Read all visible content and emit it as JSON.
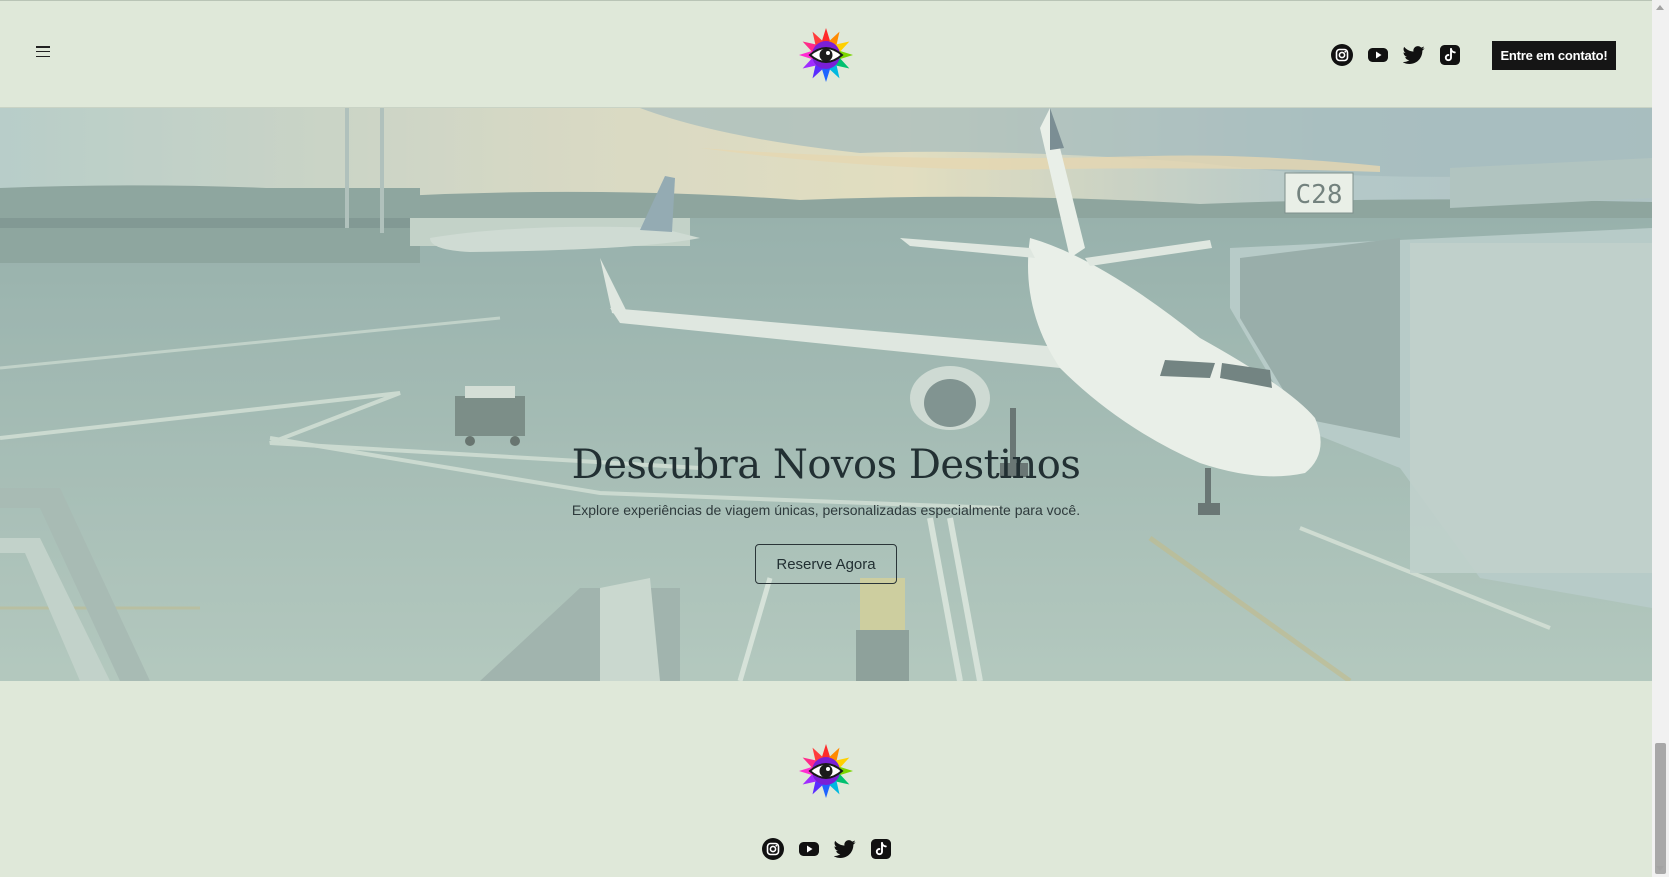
{
  "header": {
    "menu_icon": "hamburger-menu-icon",
    "logo_icon": "rainbow-eye-logo",
    "socials": [
      "instagram-icon",
      "youtube-icon",
      "twitter-icon",
      "tiktok-icon"
    ],
    "cta_label": "Entre em contato!"
  },
  "hero": {
    "title": "Descubra Novos Destinos",
    "subtitle": "Explore experiências de viagem únicas, personalizadas especialmente para você.",
    "button_label": "Reserve Agora",
    "gate_sign": "C28"
  },
  "footer": {
    "logo_icon": "rainbow-eye-logo",
    "socials": [
      "instagram-icon",
      "youtube-icon",
      "twitter-icon",
      "tiktok-icon"
    ]
  },
  "colors": {
    "background": "#dfe8d9",
    "cta_background": "#151515",
    "text": "#223033"
  }
}
